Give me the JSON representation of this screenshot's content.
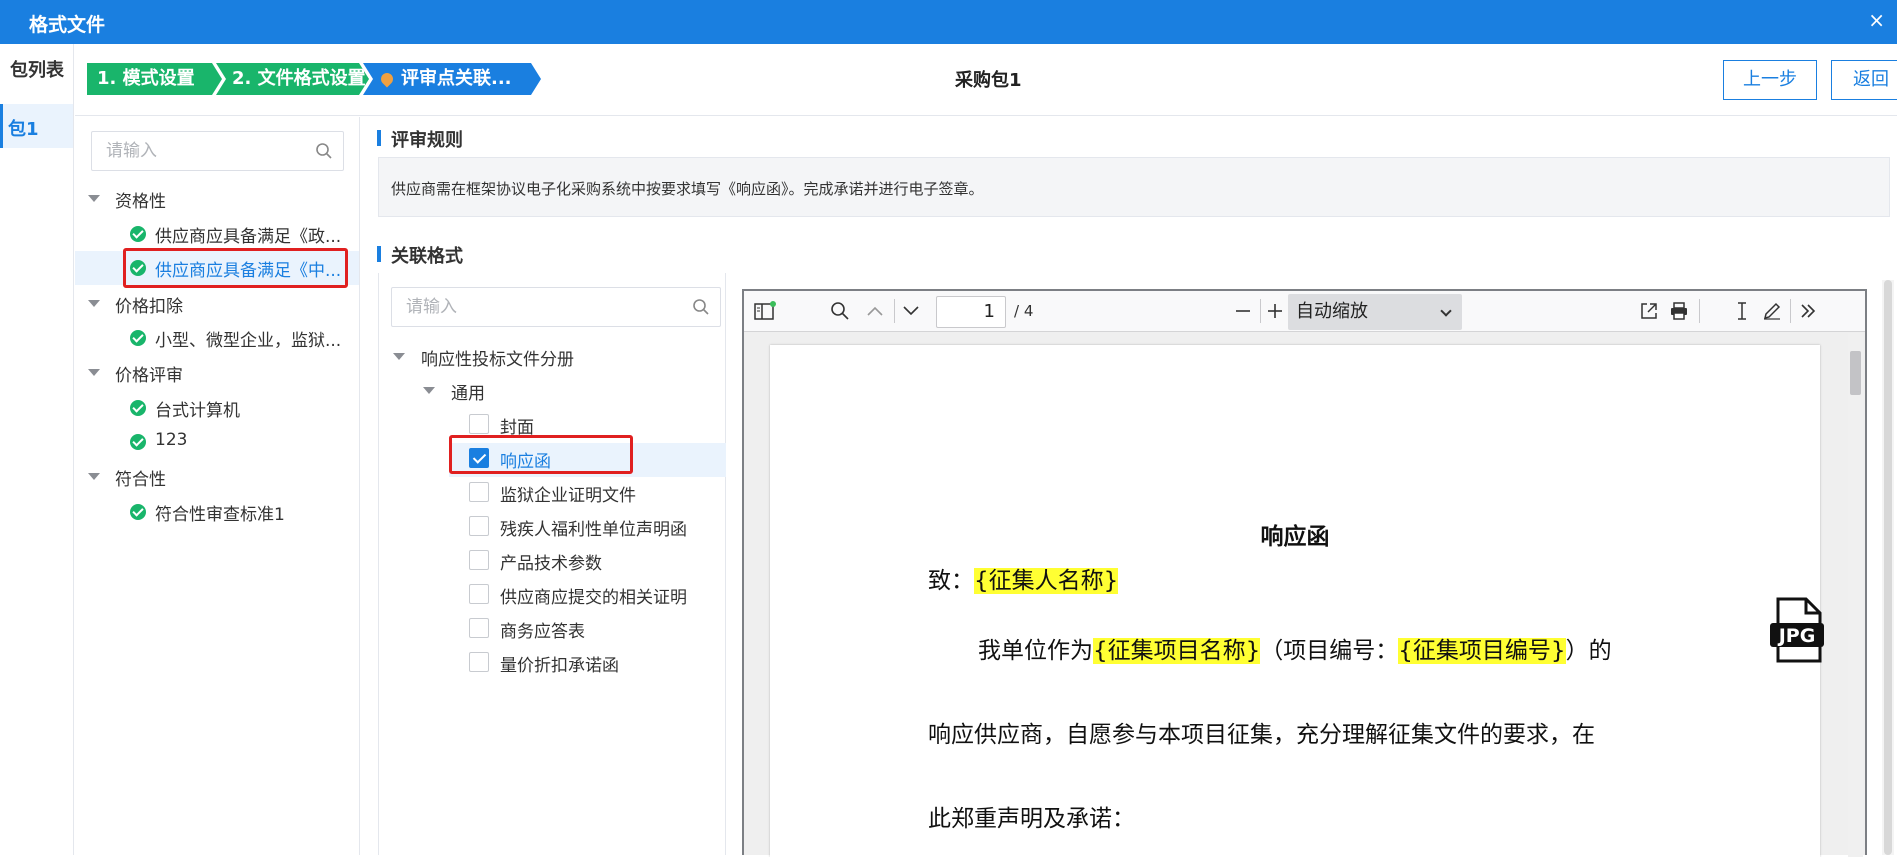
{
  "window": {
    "title": "格式文件",
    "close_glyph": "×"
  },
  "package_list": {
    "heading": "包列表",
    "items": [
      "包1"
    ]
  },
  "steps": [
    "1. 模式设置",
    "2. 文件格式设置",
    "评审点关联..."
  ],
  "package_title": "采购包1",
  "buttons": {
    "prev": "上一步",
    "back": "返回"
  },
  "left_tree": {
    "search_placeholder": "请输入",
    "groups": [
      {
        "label": "资格性",
        "items": [
          "供应商应具备满足《政...",
          "供应商应具备满足《中..."
        ]
      },
      {
        "label": "价格扣除",
        "items": [
          "小型、微型企业，监狱..."
        ]
      },
      {
        "label": "价格评审",
        "items": [
          "台式计算机",
          "123"
        ]
      },
      {
        "label": "符合性",
        "items": [
          "符合性审查标准1"
        ]
      }
    ],
    "selected_item": "供应商应具备满足《中..."
  },
  "review_rule": {
    "title": "评审规则",
    "text": "供应商需在框架协议电子化采购系统中按要求填写《响应函》。完成承诺并进行电子签章。"
  },
  "linked_format": {
    "title": "关联格式",
    "search_placeholder": "请输入",
    "root": "响应性投标文件分册",
    "group": "通用",
    "items": [
      {
        "label": "封面",
        "checked": false
      },
      {
        "label": "响应函",
        "checked": true
      },
      {
        "label": "监狱企业证明文件",
        "checked": false
      },
      {
        "label": "残疾人福利性单位声明函",
        "checked": false
      },
      {
        "label": "产品技术参数",
        "checked": false
      },
      {
        "label": "供应商应提交的相关证明",
        "checked": false
      },
      {
        "label": "商务应答表",
        "checked": false
      },
      {
        "label": "量价折扣承诺函",
        "checked": false
      }
    ]
  },
  "pdf_viewer": {
    "page_number": "1",
    "page_count": "/ 4",
    "zoom": "自动缩放",
    "icons": [
      "sidebar-toggle-icon",
      "search-icon",
      "prev-page-icon",
      "next-page-icon",
      "zoom-out-icon",
      "zoom-in-icon",
      "open-file-icon",
      "print-icon",
      "text-select-icon",
      "edit-icon",
      "more-tools-icon"
    ],
    "document": {
      "title": "响应函",
      "line1_prefix": "致：",
      "line1_field": "{征集人名称}",
      "line2_a": "我单位作为",
      "line2_field1": "{征集项目名称}",
      "line2_b": "（项目编号：",
      "line2_field2": "{征集项目编号}",
      "line2_c": "）的",
      "line3": "响应供应商，自愿参与本项目征集，充分理解征集文件的要求，在",
      "line4": "此郑重声明及承诺：",
      "badge": "JPG"
    }
  },
  "colors": {
    "primary": "#1a7fe0",
    "success": "#19b56b",
    "highlight": "#ffff33",
    "alert": "#e02020"
  }
}
